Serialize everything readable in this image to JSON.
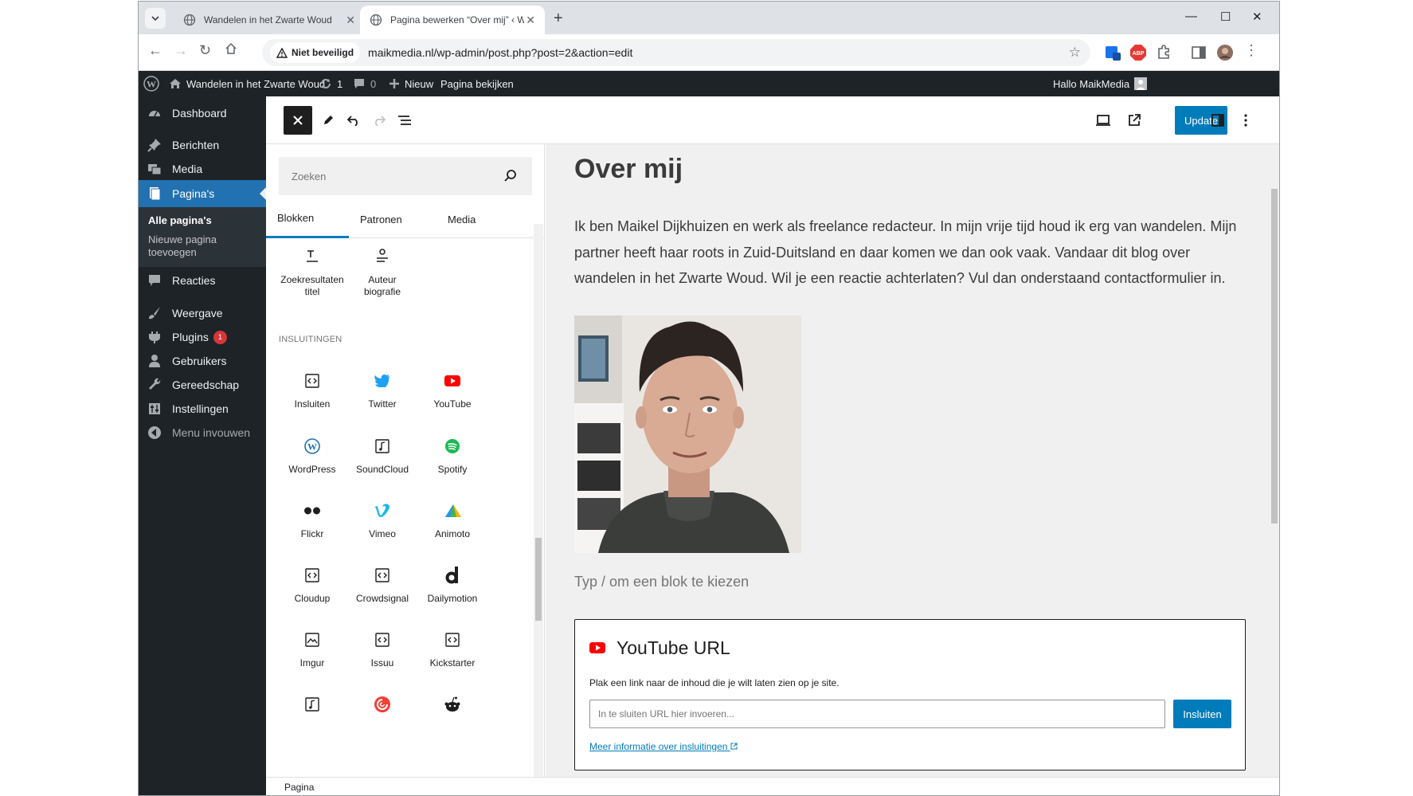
{
  "browser": {
    "tabs": [
      {
        "title": "Wandelen in het Zwarte Woud"
      },
      {
        "title": "Pagina bewerken “Over mij” ‹ W"
      }
    ],
    "security_label": "Niet beveiligd",
    "url": "maikmedia.nl/wp-admin/post.php?post=2&action=edit"
  },
  "adminbar": {
    "site_name": "Wandelen in het Zwarte Woud",
    "updates_count": "1",
    "comments_count": "0",
    "new_label": "Nieuw",
    "view_page_label": "Pagina bekijken",
    "greeting": "Hallo MaikMedia"
  },
  "sidebar": {
    "items": [
      {
        "label": "Dashboard",
        "icon": "dashboard-icon"
      },
      {
        "label": "Berichten",
        "icon": "pin-icon"
      },
      {
        "label": "Media",
        "icon": "media-icon"
      },
      {
        "label": "Pagina's",
        "icon": "pages-icon"
      },
      {
        "label": "Reacties",
        "icon": "comment-icon"
      },
      {
        "label": "Weergave",
        "icon": "brush-icon"
      },
      {
        "label": "Plugins",
        "icon": "plugin-icon",
        "badge": "1"
      },
      {
        "label": "Gebruikers",
        "icon": "user-icon"
      },
      {
        "label": "Gereedschap",
        "icon": "wrench-icon"
      },
      {
        "label": "Instellingen",
        "icon": "settings-icon"
      },
      {
        "label": "Menu invouwen",
        "icon": "collapse-icon"
      }
    ],
    "submenu": {
      "all_pages": "Alle pagina's",
      "new_page": "Nieuwe pagina toevoegen"
    }
  },
  "editor_header": {
    "update_label": "Update"
  },
  "inserter": {
    "search_placeholder": "Zoeken",
    "tabs": [
      "Blokken",
      "Patronen",
      "Media"
    ],
    "top_blocks": [
      {
        "label": "Zoekresultaten titel"
      },
      {
        "label": "Auteur biografie"
      }
    ],
    "category": "INSLUITINGEN",
    "embed_blocks": [
      {
        "label": "Insluiten",
        "icon": "embed-generic-icon"
      },
      {
        "label": "Twitter",
        "icon": "twitter-icon"
      },
      {
        "label": "YouTube",
        "icon": "youtube-icon"
      },
      {
        "label": "WordPress",
        "icon": "wordpress-icon"
      },
      {
        "label": "SoundCloud",
        "icon": "audio-icon"
      },
      {
        "label": "Spotify",
        "icon": "spotify-icon"
      },
      {
        "label": "Flickr",
        "icon": "flickr-icon"
      },
      {
        "label": "Vimeo",
        "icon": "vimeo-icon"
      },
      {
        "label": "Animoto",
        "icon": "animoto-icon"
      },
      {
        "label": "Cloudup",
        "icon": "embed-generic-icon"
      },
      {
        "label": "Crowdsignal",
        "icon": "embed-generic-icon"
      },
      {
        "label": "Dailymotion",
        "icon": "dailymotion-icon"
      },
      {
        "label": "Imgur",
        "icon": "image-icon"
      },
      {
        "label": "Issuu",
        "icon": "embed-generic-icon"
      },
      {
        "label": "Kickstarter",
        "icon": "embed-generic-icon"
      }
    ]
  },
  "content": {
    "title": "Over mij",
    "paragraph": "Ik ben Maikel Dijkhuizen en werk als freelance redacteur. In mijn vrije tijd houd ik erg van wandelen. Mijn partner heeft haar roots in Zuid-Duitsland en daar komen we dan ook vaak. Vandaar dit blog over wandelen in het Zwarte Woud. Wil je een reactie achterlaten? Vul dan onderstaand contactformulier in.",
    "block_placeholder": "Typ / om een blok te kiezen",
    "embed": {
      "title": "YouTube URL",
      "help": "Plak een link naar de inhoud die je wilt laten zien op je site.",
      "input_placeholder": "In te sluiten URL hier invoeren...",
      "button": "Insluiten",
      "link": "Meer informatie over insluitingen"
    }
  },
  "footer": {
    "breadcrumb": "Pagina"
  },
  "colors": {
    "wp_blue": "#007cba",
    "admin_dark": "#1d2327",
    "menu_current": "#2271b1",
    "badge_red": "#d63638",
    "youtube_red": "#ff0000"
  }
}
